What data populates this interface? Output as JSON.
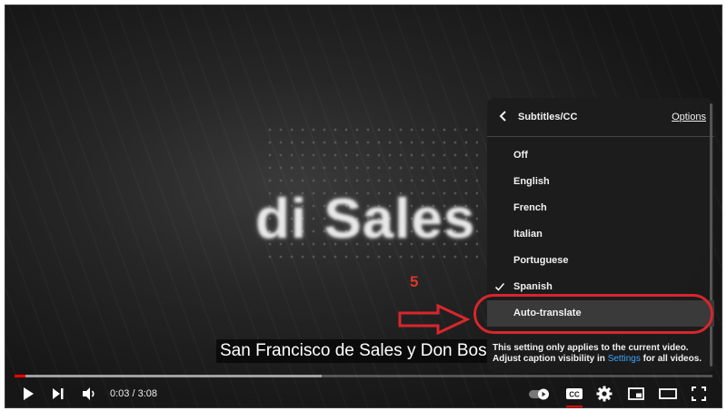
{
  "video": {
    "title_text": "di Sales",
    "caption": "San Francisco de Sales y Don Bos"
  },
  "annotation": {
    "step_number": "5"
  },
  "menu": {
    "title": "Subtitles/CC",
    "options_label": "Options",
    "items": [
      {
        "label": "Off",
        "selected": false
      },
      {
        "label": "English",
        "selected": false
      },
      {
        "label": "French",
        "selected": false
      },
      {
        "label": "Italian",
        "selected": false
      },
      {
        "label": "Portuguese",
        "selected": false
      },
      {
        "label": "Spanish",
        "selected": true
      },
      {
        "label": "Auto-translate",
        "selected": false,
        "highlighted": true
      }
    ],
    "note_before": "This setting only applies to the current video. Adjust caption visibility in ",
    "note_link": "Settings",
    "note_after": " for all videos."
  },
  "player": {
    "current_time": "0:03",
    "duration": "3:08",
    "time_display": "0:03 / 3:08",
    "played_fraction": 0.016,
    "buffered_fraction": 0.44
  },
  "colors": {
    "accent_red": "#ff0000",
    "annotation_red": "#d8262c",
    "link_blue": "#3ea6ff"
  },
  "icons": [
    "play-icon",
    "next-icon",
    "volume-icon",
    "autoplay-toggle-icon",
    "cc-icon",
    "settings-gear-icon",
    "miniplayer-icon",
    "theater-mode-icon",
    "fullscreen-icon",
    "back-chevron-icon",
    "checkmark-icon"
  ]
}
